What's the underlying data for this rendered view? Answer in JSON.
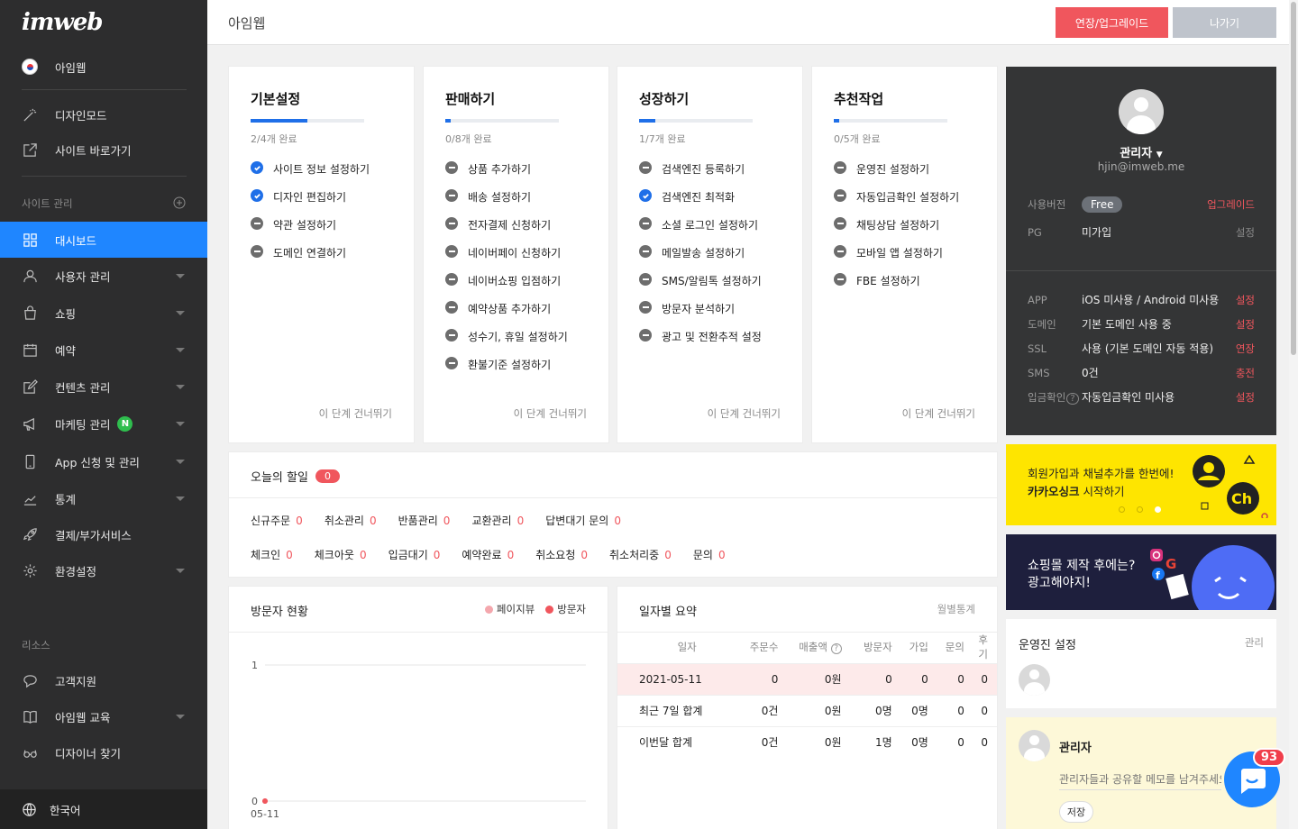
{
  "app": {
    "logo": "imweb",
    "page_title": "아임웹"
  },
  "topbar": {
    "upgrade_label": "연장/업그레이드",
    "exit_label": "나가기"
  },
  "sidebar": {
    "site_name": "아임웹",
    "top_items": [
      {
        "label": "디자인모드",
        "icon": "magic-wand-icon"
      },
      {
        "label": "사이트 바로가기",
        "icon": "external-link-icon"
      }
    ],
    "section_manage": "사이트 관리",
    "items": [
      {
        "label": "대시보드",
        "icon": "dashboard-icon",
        "active": true
      },
      {
        "label": "사용자 관리",
        "icon": "user-icon"
      },
      {
        "label": "쇼핑",
        "icon": "shopping-bag-icon"
      },
      {
        "label": "예약",
        "icon": "calendar-icon"
      },
      {
        "label": "컨텐츠 관리",
        "icon": "edit-icon"
      },
      {
        "label": "마케팅 관리",
        "icon": "megaphone-icon",
        "badge": "N"
      },
      {
        "label": "App 신청 및 관리",
        "icon": "mobile-icon"
      },
      {
        "label": "통계",
        "icon": "chart-icon"
      },
      {
        "label": "결제/부가서비스",
        "icon": "rocket-icon"
      },
      {
        "label": "환경설정",
        "icon": "gear-icon"
      }
    ],
    "section_resources": "리소스",
    "resources": [
      {
        "label": "고객지원",
        "icon": "chat-icon"
      },
      {
        "label": "아임웹 교육",
        "icon": "book-icon"
      },
      {
        "label": "디자이너 찾기",
        "icon": "glasses-icon"
      }
    ],
    "language": "한국어"
  },
  "steps": [
    {
      "title": "기본설정",
      "progress": 0.5,
      "count": "2/4개 완료",
      "skip": "이 단계 건너뛰기",
      "items": [
        {
          "label": "사이트 정보 설정하기",
          "done": true
        },
        {
          "label": "디자인 편집하기",
          "done": true
        },
        {
          "label": "약관 설정하기",
          "done": false
        },
        {
          "label": "도메인 연결하기",
          "done": false
        }
      ]
    },
    {
      "title": "판매하기",
      "progress": 0.04,
      "count": "0/8개 완료",
      "skip": "이 단계 건너뛰기",
      "items": [
        {
          "label": "상품 추가하기",
          "done": false
        },
        {
          "label": "배송 설정하기",
          "done": false
        },
        {
          "label": "전자결제 신청하기",
          "done": false
        },
        {
          "label": "네이버페이 신청하기",
          "done": false
        },
        {
          "label": "네이버쇼핑 입점하기",
          "done": false
        },
        {
          "label": "예약상품 추가하기",
          "done": false
        },
        {
          "label": "성수기, 휴일 설정하기",
          "done": false
        },
        {
          "label": "환불기준 설정하기",
          "done": false
        }
      ]
    },
    {
      "title": "성장하기",
      "progress": 0.14,
      "count": "1/7개 완료",
      "skip": "이 단계 건너뛰기",
      "items": [
        {
          "label": "검색엔진 등록하기",
          "done": false
        },
        {
          "label": "검색엔진 최적화",
          "done": true
        },
        {
          "label": "소셜 로그인 설정하기",
          "done": false
        },
        {
          "label": "메일발송 설정하기",
          "done": false
        },
        {
          "label": "SMS/알림톡 설정하기",
          "done": false
        },
        {
          "label": "방문자 분석하기",
          "done": false
        },
        {
          "label": "광고 및 전환추적 설정",
          "done": false
        }
      ]
    },
    {
      "title": "추천작업",
      "progress": 0.04,
      "count": "0/5개 완료",
      "skip": "이 단계 건너뛰기",
      "items": [
        {
          "label": "운영진 설정하기",
          "done": false
        },
        {
          "label": "자동입금확인 설정하기",
          "done": false
        },
        {
          "label": "채팅상담 설정하기",
          "done": false
        },
        {
          "label": "모바일 앱 설정하기",
          "done": false
        },
        {
          "label": "FBE 설정하기",
          "done": false
        }
      ]
    }
  ],
  "todo": {
    "title": "오늘의 할일",
    "total": "0",
    "row1": [
      {
        "label": "신규주문",
        "count": "0"
      },
      {
        "label": "취소관리",
        "count": "0"
      },
      {
        "label": "반품관리",
        "count": "0"
      },
      {
        "label": "교환관리",
        "count": "0"
      },
      {
        "label": "답변대기 문의",
        "count": "0"
      }
    ],
    "row2": [
      {
        "label": "체크인",
        "count": "0"
      },
      {
        "label": "체크아웃",
        "count": "0"
      },
      {
        "label": "입금대기",
        "count": "0"
      },
      {
        "label": "예약완료",
        "count": "0"
      },
      {
        "label": "취소요청",
        "count": "0"
      },
      {
        "label": "취소처리중",
        "count": "0"
      },
      {
        "label": "문의",
        "count": "0"
      }
    ]
  },
  "visitors": {
    "title": "방문자 현황",
    "legend": [
      {
        "label": "페이지뷰",
        "color": "#f4a7ad"
      },
      {
        "label": "방문자",
        "color": "#f0565d"
      }
    ]
  },
  "chart_data": {
    "type": "line",
    "x": [
      "05-11"
    ],
    "series": [
      {
        "name": "페이지뷰",
        "values": [
          0
        ]
      },
      {
        "name": "방문자",
        "values": [
          0
        ]
      }
    ],
    "yticks": [
      "1",
      "0"
    ],
    "ylim": [
      0,
      1
    ]
  },
  "daily": {
    "title": "일자별 요약",
    "link": "월별통계",
    "headers": [
      "일자",
      "주문수",
      "매출액",
      "방문자",
      "가입",
      "문의",
      "후기"
    ],
    "rows": [
      [
        "2021-05-11",
        "0",
        "0원",
        "0",
        "0",
        "0",
        "0"
      ],
      [
        "최근 7일 합계",
        "0건",
        "0원",
        "0명",
        "0명",
        "0",
        "0"
      ],
      [
        "이번달 합계",
        "0건",
        "0원",
        "1명",
        "0명",
        "0",
        "0"
      ]
    ]
  },
  "profile": {
    "name": "관리자",
    "email": "hjin@imweb.me",
    "version_label": "사용버전",
    "version": "Free",
    "upgrade": "업그레이드",
    "pg_label": "PG",
    "pg": "미가입",
    "pg_action": "설정",
    "rows": [
      {
        "k": "APP",
        "v": "iOS 미사용 / Android 미사용",
        "a": "설정"
      },
      {
        "k": "도메인",
        "v": "기본 도메인 사용 중",
        "a": "설정"
      },
      {
        "k": "SSL",
        "v": "사용 (기본 도메인 자동 적용)",
        "a": "연장"
      },
      {
        "k": "SMS",
        "v": "0건",
        "a": "충전"
      },
      {
        "k": "입금확인",
        "v": "자동입금확인 미사용",
        "a": "설정"
      }
    ]
  },
  "kakao": {
    "line1": "회원가입과 채널추가를 한번에!",
    "line2_bold": "카카오싱크",
    "line2_rest": " 시작하기"
  },
  "ad": {
    "line1": "쇼핑몰 제작 후에는?",
    "line2": "광고해야지!"
  },
  "operators": {
    "title": "운영진 설정",
    "manage": "관리"
  },
  "memo": {
    "name": "관리자",
    "placeholder": "관리자들과 공유할 메모를 남겨주세요",
    "save": "저장"
  },
  "chat": {
    "badge": "93"
  }
}
